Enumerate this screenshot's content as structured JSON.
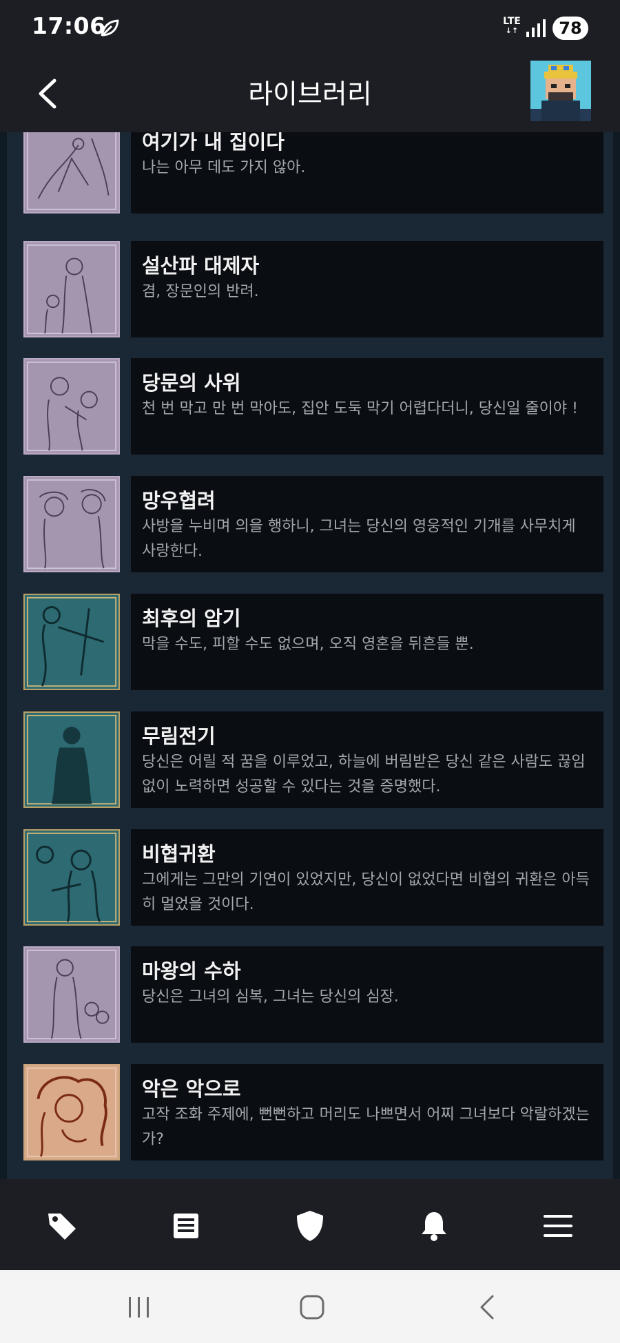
{
  "status": {
    "time": "17:06",
    "network": "LTE",
    "battery": "78"
  },
  "header": {
    "title": "라이브러리"
  },
  "achievements": [
    {
      "title": "여기가 내 집이다",
      "description": "나는 아무 데도 가지 않아.",
      "tone": "lavender"
    },
    {
      "title": "설산파 대제자",
      "description": "겸, 장문인의 반려.",
      "tone": "lavender"
    },
    {
      "title": "당문의 사위",
      "description": "천 번 막고 만 번 막아도, 집안 도둑 막기 어렵다더니, 당신일 줄이야 !",
      "tone": "lavender"
    },
    {
      "title": "망우협려",
      "description": "사방을 누비며 의을 행하니, 그녀는 당신의 영웅적인 기개를 사무치게 사랑한다.",
      "tone": "lavender"
    },
    {
      "title": "최후의 암기",
      "description": "막을 수도, 피할 수도 없으며, 오직 영혼을 뒤흔들 뿐.",
      "tone": "teal"
    },
    {
      "title": "무림전기",
      "description": "당신은 어릴 적 꿈을 이루었고, 하늘에 버림받은 당신 같은 사람도 끊임없이 노력하면 성공할 수 있다는 것을 증명했다.",
      "tone": "teal"
    },
    {
      "title": "비협귀환",
      "description": "그에게는 그만의 기연이 있었지만, 당신이 없었다면 비협의 귀환은 아득히 멀었을 것이다.",
      "tone": "teal"
    },
    {
      "title": "마왕의 수하",
      "description": "당신은 그녀의 심복, 그녀는 당신의 심장.",
      "tone": "lavender"
    },
    {
      "title": "악은 악으로",
      "description": "고작 조화 주제에, 뻔뻔하고 머리도 나쁘면서 어찌 그녀보다 악랄하겠는가?",
      "tone": "warm"
    }
  ],
  "bottom_nav": [
    "tag-icon",
    "news-icon",
    "shield-icon",
    "bell-icon",
    "menu-icon"
  ],
  "system_nav": [
    "recents-icon",
    "home-icon",
    "back-icon"
  ],
  "colors": {
    "lavender": "#a596b0",
    "teal": "#2d6a72",
    "warm": "#d9a98a",
    "card": "#0a0d12",
    "list_bg": "#1a2836"
  }
}
